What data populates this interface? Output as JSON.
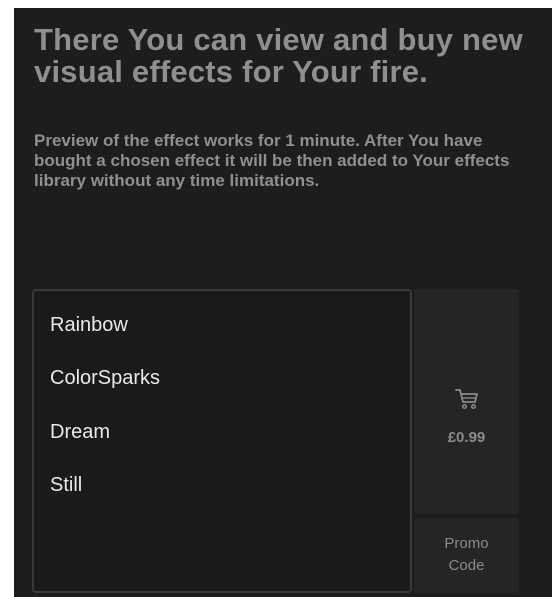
{
  "header": {
    "title": "There You can view and buy new visual effects for Your fire.",
    "description": "Preview of the effect works for 1 minute. After You have bought a chosen effect it will be then added to Your effects library without any time limitations."
  },
  "effects": [
    {
      "label": "Rainbow"
    },
    {
      "label": "ColorSparks"
    },
    {
      "label": "Dream"
    },
    {
      "label": "Still"
    }
  ],
  "purchase": {
    "icon": "cart-icon",
    "price": "£0.99"
  },
  "promo": {
    "line1": "Promo",
    "line2": "Code"
  },
  "colors": {
    "background": "#1d1d1d",
    "panel": "#252525",
    "heading_text": "#8f8f8f",
    "item_text": "#eaeaea"
  }
}
